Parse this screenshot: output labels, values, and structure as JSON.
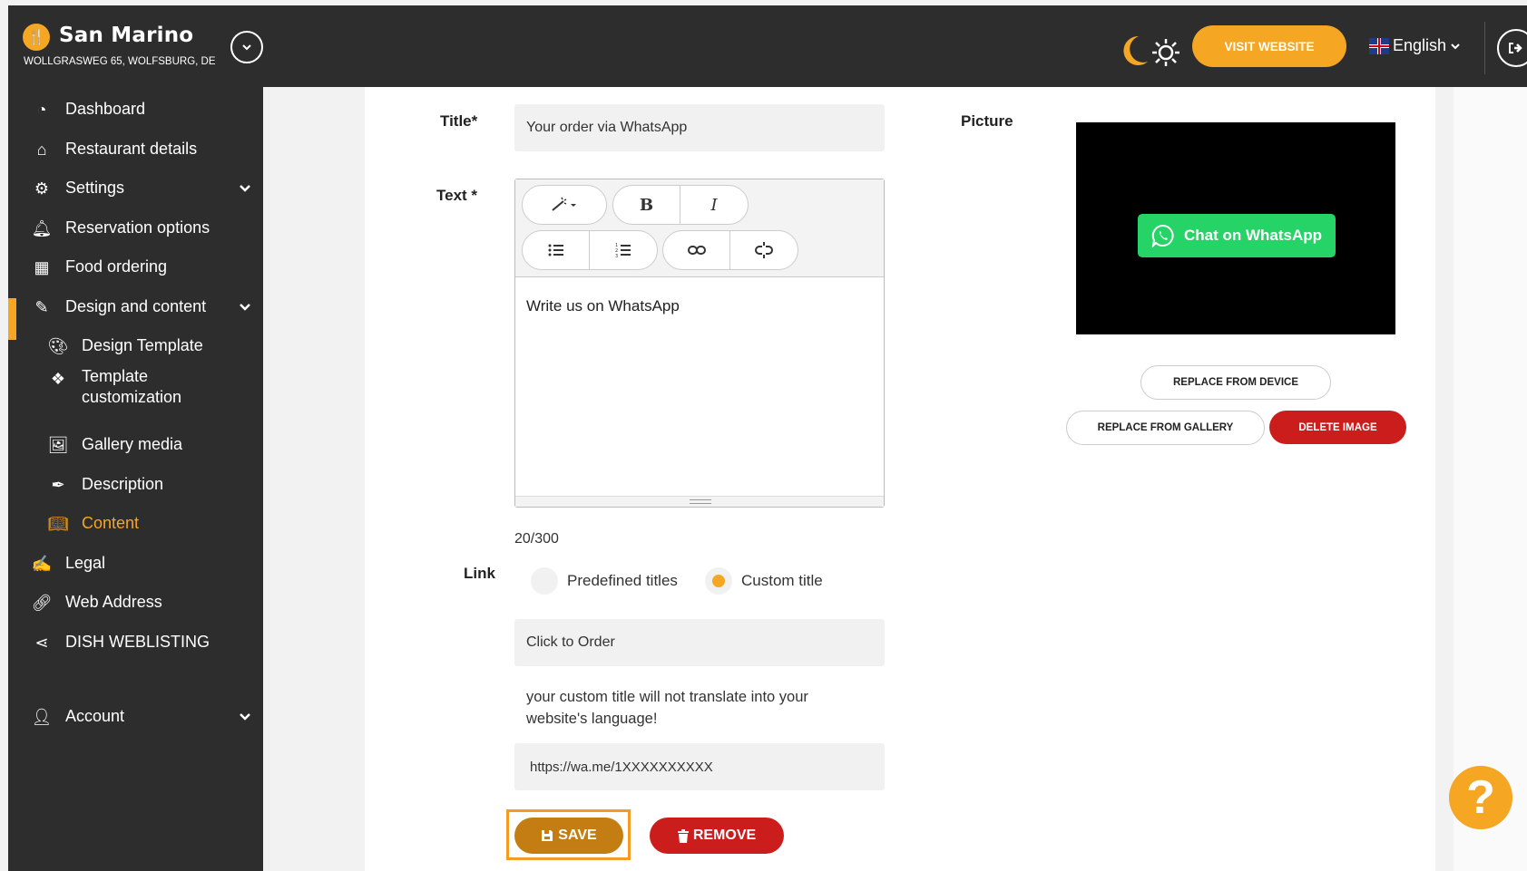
{
  "header": {
    "brand_name": "San Marino",
    "brand_address": "WOLLGRASWEG 65, WOLFSBURG, DE",
    "visit_website": "VISIT WEBSITE",
    "language": "English"
  },
  "sidebar": {
    "items": [
      {
        "label": "Dashboard",
        "icon": "dashboard-icon"
      },
      {
        "label": "Restaurant details",
        "icon": "home-icon"
      },
      {
        "label": "Settings",
        "icon": "gear-icon"
      },
      {
        "label": "Reservation options",
        "icon": "bell-icon"
      },
      {
        "label": "Food ordering",
        "icon": "food-ordering-icon"
      },
      {
        "label": "Design and content",
        "icon": "brush-icon"
      },
      {
        "label": "Design Template",
        "icon": "palette-icon"
      },
      {
        "label": "Template",
        "label2": "customization",
        "icon": "template-icon"
      },
      {
        "label": "Gallery media",
        "icon": "image-icon"
      },
      {
        "label": "Description",
        "icon": "pen-icon"
      },
      {
        "label": "Content",
        "icon": "book-icon"
      },
      {
        "label": "Legal",
        "icon": "legal-icon"
      },
      {
        "label": "Web Address",
        "icon": "link-icon"
      },
      {
        "label": "DISH WEBLISTING",
        "icon": "share-icon"
      },
      {
        "label": "Account",
        "icon": "user-icon"
      }
    ]
  },
  "form": {
    "title_label": "Title*",
    "title_value": "Your order via WhatsApp",
    "text_label": "Text *",
    "text_value": "Write us on WhatsApp",
    "char_count": "20/300",
    "link_label": "Link",
    "radio_predefined": "Predefined titles",
    "radio_custom": "Custom title",
    "custom_title_value": "Click to Order",
    "hint": "your custom title will not translate into your website's language!",
    "url_value": "https://wa.me/1XXXXXXXXXX",
    "save": "SAVE",
    "remove": "REMOVE"
  },
  "toolbar": {
    "bold": "B",
    "italic": "I"
  },
  "picture": {
    "label": "Picture",
    "whatsapp_button": "Chat on WhatsApp",
    "replace_device": "REPLACE FROM DEVICE",
    "replace_gallery": "REPLACE FROM GALLERY",
    "delete_image": "DELETE IMAGE"
  },
  "colors": {
    "accent": "#f5a623",
    "dark": "#2d2d2d",
    "danger": "#cc1d1d",
    "whatsapp": "#25d366"
  }
}
